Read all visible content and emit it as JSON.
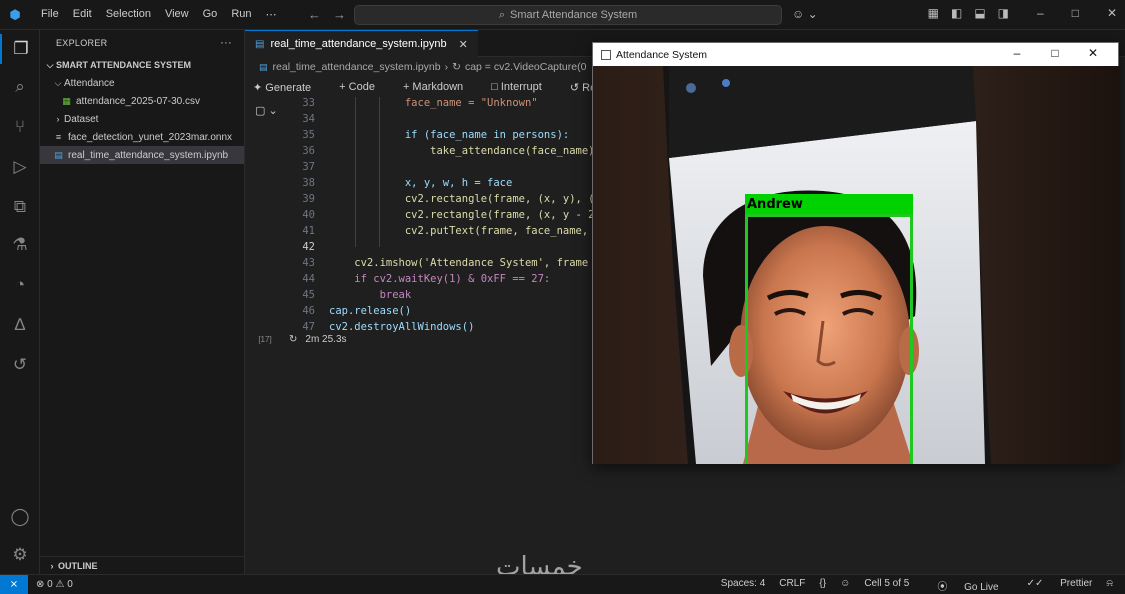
{
  "titlebar": {
    "menu": [
      "File",
      "Edit",
      "Selection",
      "View",
      "Go",
      "Run",
      "⋯"
    ],
    "search_text": "Smart Attendance System",
    "logo": "vscode-logo"
  },
  "activity_icons": [
    "files-icon",
    "search-icon",
    "source-control-icon",
    "run-debug-icon",
    "extensions-icon",
    "testing-icon",
    "remote-icon",
    "azure-icon",
    "timeline-icon",
    "account-icon",
    "settings-gear-icon"
  ],
  "sidebar": {
    "header": "EXPLORER",
    "more": "···",
    "project": "SMART ATTENDANCE SYSTEM",
    "items": [
      {
        "label": "Attendance",
        "type": "folder-open",
        "indent": 1
      },
      {
        "label": "attendance_2025-07-30.csv",
        "type": "csv",
        "indent": 2
      },
      {
        "label": "Dataset",
        "type": "folder",
        "indent": 1
      },
      {
        "label": "face_detection_yunet_2023mar.onnx",
        "type": "file",
        "indent": 1
      },
      {
        "label": "real_time_attendance_system.ipynb",
        "type": "notebook",
        "indent": 1,
        "selected": true
      }
    ],
    "outline": "OUTLINE"
  },
  "editor": {
    "tab_label": "real_time_attendance_system.ipynb",
    "breadcrumb_file": "real_time_attendance_system.ipynb",
    "breadcrumb_sep": "›",
    "breadcrumb_symbol": "cap = cv2.VideoCapture(0",
    "toolbar": {
      "generate": "Generate",
      "code": "Code",
      "markdown": "Markdown",
      "interrupt": "Interrupt",
      "restart": "Restart"
    },
    "cell_count": "[17]",
    "cell_time": "2m 25.3s",
    "lines": [
      {
        "n": "33",
        "code": "            face_name = \"Unknown\""
      },
      {
        "n": "34",
        "code": ""
      },
      {
        "n": "35",
        "code": "            if (face_name in persons):"
      },
      {
        "n": "36",
        "code": "                take_attendance(face_name)"
      },
      {
        "n": "37",
        "code": ""
      },
      {
        "n": "38",
        "code": "            x, y, w, h = face"
      },
      {
        "n": "39",
        "code": "            cv2.rectangle(frame, (x, y), ("
      },
      {
        "n": "40",
        "code": "            cv2.rectangle(frame, (x, y - 2"
      },
      {
        "n": "41",
        "code": "            cv2.putText(frame, face_name, "
      },
      {
        "n": "42",
        "code": ""
      },
      {
        "n": "43",
        "code": "    cv2.imshow('Attendance System', frame"
      },
      {
        "n": "44",
        "code": "    if cv2.waitKey(1) & 0xFF == 27:"
      },
      {
        "n": "45",
        "code": "        break"
      },
      {
        "n": "46",
        "code": "cap.release()"
      },
      {
        "n": "47",
        "code": "cv2.destroyAllWindows()"
      }
    ]
  },
  "attendance_window": {
    "title": "Attendance System",
    "detected_name": "Andrew",
    "box_color": "#1ec81e"
  },
  "watermark": "خمسات",
  "statusbar": {
    "remote": "⨯",
    "problems": "⊗ 0 ⚠ 0",
    "spaces": "Spaces: 4",
    "eol": "CRLF",
    "braces": "{}",
    "cell": "Cell 5 of 5",
    "golive": "Go Live",
    "prettier": "Prettier"
  },
  "colors": {
    "accent": "#0078d4",
    "background": "#1f1f1f",
    "sidebar": "#181818"
  }
}
